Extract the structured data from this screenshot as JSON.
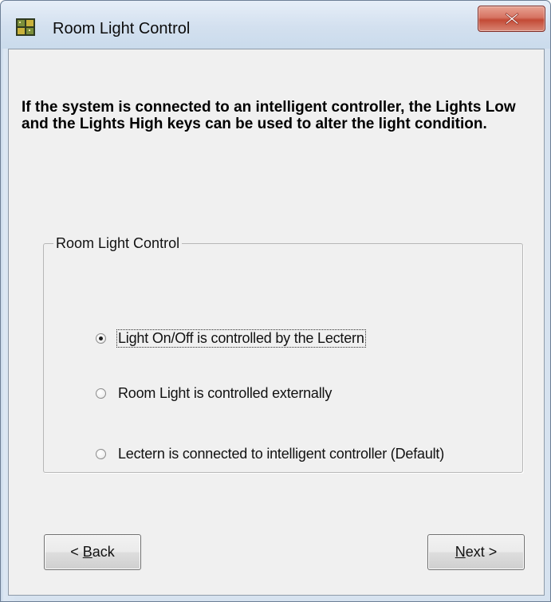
{
  "window": {
    "title": "Room Light Control"
  },
  "description": "If the system is connected to an intelligent controller, the Lights Low and the Lights High keys can be used to alter the light condition.",
  "group": {
    "caption": "Room Light Control",
    "options": [
      {
        "label": "Light On/Off is controlled by the Lectern",
        "selected": true
      },
      {
        "label": "Room Light is controlled externally",
        "selected": false
      },
      {
        "label": "Lectern is connected to intelligent controller (Default)",
        "selected": false
      }
    ]
  },
  "buttons": {
    "back": {
      "prefix": "< ",
      "mnemonic": "B",
      "rest": "ack"
    },
    "next": {
      "mnemonic": "N",
      "rest": "ext >"
    }
  },
  "icons": {
    "app": "circuit-board-icon",
    "close": "close-x-icon"
  },
  "colors": {
    "close_button": "#c34a35",
    "client_background": "#f0f0f0",
    "frame": "#d6e2ef"
  }
}
